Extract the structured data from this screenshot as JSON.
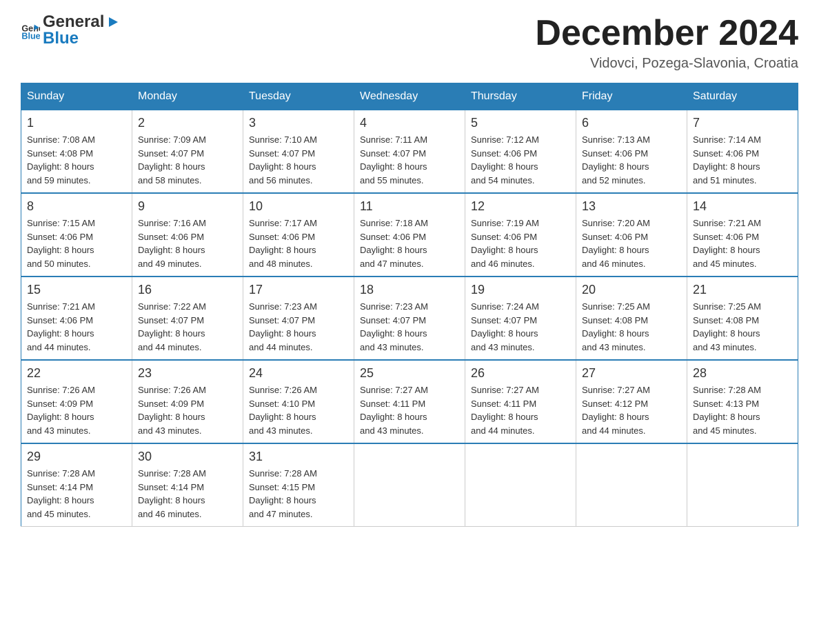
{
  "logo": {
    "general": "General",
    "arrow": "▶",
    "blue": "Blue"
  },
  "header": {
    "month": "December 2024",
    "location": "Vidovci, Pozega-Slavonia, Croatia"
  },
  "weekdays": [
    "Sunday",
    "Monday",
    "Tuesday",
    "Wednesday",
    "Thursday",
    "Friday",
    "Saturday"
  ],
  "weeks": [
    [
      {
        "day": "1",
        "sunrise": "7:08 AM",
        "sunset": "4:08 PM",
        "daylight": "8 hours and 59 minutes."
      },
      {
        "day": "2",
        "sunrise": "7:09 AM",
        "sunset": "4:07 PM",
        "daylight": "8 hours and 58 minutes."
      },
      {
        "day": "3",
        "sunrise": "7:10 AM",
        "sunset": "4:07 PM",
        "daylight": "8 hours and 56 minutes."
      },
      {
        "day": "4",
        "sunrise": "7:11 AM",
        "sunset": "4:07 PM",
        "daylight": "8 hours and 55 minutes."
      },
      {
        "day": "5",
        "sunrise": "7:12 AM",
        "sunset": "4:06 PM",
        "daylight": "8 hours and 54 minutes."
      },
      {
        "day": "6",
        "sunrise": "7:13 AM",
        "sunset": "4:06 PM",
        "daylight": "8 hours and 52 minutes."
      },
      {
        "day": "7",
        "sunrise": "7:14 AM",
        "sunset": "4:06 PM",
        "daylight": "8 hours and 51 minutes."
      }
    ],
    [
      {
        "day": "8",
        "sunrise": "7:15 AM",
        "sunset": "4:06 PM",
        "daylight": "8 hours and 50 minutes."
      },
      {
        "day": "9",
        "sunrise": "7:16 AM",
        "sunset": "4:06 PM",
        "daylight": "8 hours and 49 minutes."
      },
      {
        "day": "10",
        "sunrise": "7:17 AM",
        "sunset": "4:06 PM",
        "daylight": "8 hours and 48 minutes."
      },
      {
        "day": "11",
        "sunrise": "7:18 AM",
        "sunset": "4:06 PM",
        "daylight": "8 hours and 47 minutes."
      },
      {
        "day": "12",
        "sunrise": "7:19 AM",
        "sunset": "4:06 PM",
        "daylight": "8 hours and 46 minutes."
      },
      {
        "day": "13",
        "sunrise": "7:20 AM",
        "sunset": "4:06 PM",
        "daylight": "8 hours and 46 minutes."
      },
      {
        "day": "14",
        "sunrise": "7:21 AM",
        "sunset": "4:06 PM",
        "daylight": "8 hours and 45 minutes."
      }
    ],
    [
      {
        "day": "15",
        "sunrise": "7:21 AM",
        "sunset": "4:06 PM",
        "daylight": "8 hours and 44 minutes."
      },
      {
        "day": "16",
        "sunrise": "7:22 AM",
        "sunset": "4:07 PM",
        "daylight": "8 hours and 44 minutes."
      },
      {
        "day": "17",
        "sunrise": "7:23 AM",
        "sunset": "4:07 PM",
        "daylight": "8 hours and 44 minutes."
      },
      {
        "day": "18",
        "sunrise": "7:23 AM",
        "sunset": "4:07 PM",
        "daylight": "8 hours and 43 minutes."
      },
      {
        "day": "19",
        "sunrise": "7:24 AM",
        "sunset": "4:07 PM",
        "daylight": "8 hours and 43 minutes."
      },
      {
        "day": "20",
        "sunrise": "7:25 AM",
        "sunset": "4:08 PM",
        "daylight": "8 hours and 43 minutes."
      },
      {
        "day": "21",
        "sunrise": "7:25 AM",
        "sunset": "4:08 PM",
        "daylight": "8 hours and 43 minutes."
      }
    ],
    [
      {
        "day": "22",
        "sunrise": "7:26 AM",
        "sunset": "4:09 PM",
        "daylight": "8 hours and 43 minutes."
      },
      {
        "day": "23",
        "sunrise": "7:26 AM",
        "sunset": "4:09 PM",
        "daylight": "8 hours and 43 minutes."
      },
      {
        "day": "24",
        "sunrise": "7:26 AM",
        "sunset": "4:10 PM",
        "daylight": "8 hours and 43 minutes."
      },
      {
        "day": "25",
        "sunrise": "7:27 AM",
        "sunset": "4:11 PM",
        "daylight": "8 hours and 43 minutes."
      },
      {
        "day": "26",
        "sunrise": "7:27 AM",
        "sunset": "4:11 PM",
        "daylight": "8 hours and 44 minutes."
      },
      {
        "day": "27",
        "sunrise": "7:27 AM",
        "sunset": "4:12 PM",
        "daylight": "8 hours and 44 minutes."
      },
      {
        "day": "28",
        "sunrise": "7:28 AM",
        "sunset": "4:13 PM",
        "daylight": "8 hours and 45 minutes."
      }
    ],
    [
      {
        "day": "29",
        "sunrise": "7:28 AM",
        "sunset": "4:14 PM",
        "daylight": "8 hours and 45 minutes."
      },
      {
        "day": "30",
        "sunrise": "7:28 AM",
        "sunset": "4:14 PM",
        "daylight": "8 hours and 46 minutes."
      },
      {
        "day": "31",
        "sunrise": "7:28 AM",
        "sunset": "4:15 PM",
        "daylight": "8 hours and 47 minutes."
      },
      null,
      null,
      null,
      null
    ]
  ],
  "labels": {
    "sunrise": "Sunrise:",
    "sunset": "Sunset:",
    "daylight": "Daylight:"
  }
}
